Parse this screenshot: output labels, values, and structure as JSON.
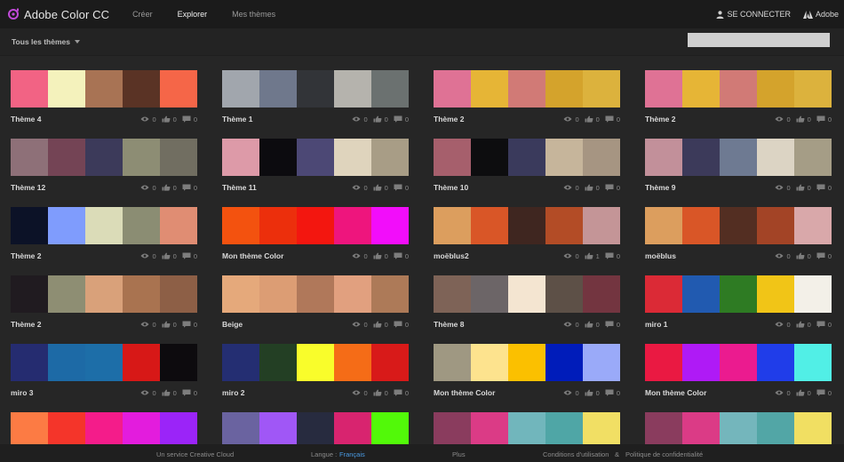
{
  "header": {
    "brand": "Adobe Color CC",
    "nav": [
      "Créer",
      "Explorer",
      "Mes thèmes"
    ],
    "active_nav": 1,
    "connect_label": "SE CONNECTER",
    "adobe_label": "Adobe"
  },
  "filter": {
    "label": "Tous les thèmes",
    "search_value": ""
  },
  "themes": [
    {
      "name": "Thème 4",
      "colors": [
        "#f26384",
        "#f4f2bc",
        "#a87354",
        "#5a3325",
        "#f56648"
      ],
      "views": "0",
      "likes": "0",
      "comments": "0"
    },
    {
      "name": "Thème 1",
      "colors": [
        "#a1a6ad",
        "#6f788c",
        "#323438",
        "#b5b3ad",
        "#6b7170"
      ],
      "views": "0",
      "likes": "0",
      "comments": "0"
    },
    {
      "name": "Thème 2",
      "colors": [
        "#df7295",
        "#e6b536",
        "#d17a76",
        "#d4a32c",
        "#dcb23d"
      ],
      "views": "0",
      "likes": "0",
      "comments": "0"
    },
    {
      "name": "Thème 2",
      "colors": [
        "#df7295",
        "#e6b536",
        "#d17a76",
        "#d4a32c",
        "#dcb23d"
      ],
      "views": "0",
      "likes": "0",
      "comments": "0"
    },
    {
      "name": "Thème 12",
      "colors": [
        "#8e7078",
        "#744455",
        "#3c3a5a",
        "#8d8d74",
        "#716e61"
      ],
      "views": "0",
      "likes": "0",
      "comments": "0"
    },
    {
      "name": "Thème 11",
      "colors": [
        "#dd9aa8",
        "#0c0b0f",
        "#4c4875",
        "#dfd4bd",
        "#a89d86"
      ],
      "views": "0",
      "likes": "0",
      "comments": "0"
    },
    {
      "name": "Thème 10",
      "colors": [
        "#a65f6c",
        "#0d0d0f",
        "#3a3a5c",
        "#c6b59b",
        "#a69582"
      ],
      "views": "0",
      "likes": "0",
      "comments": "0"
    },
    {
      "name": "Thème 9",
      "colors": [
        "#c2909a",
        "#3c3a5a",
        "#6e7a92",
        "#dcd4c4",
        "#a59d86"
      ],
      "views": "0",
      "likes": "0",
      "comments": "0"
    },
    {
      "name": "Thème 2",
      "colors": [
        "#0c1227",
        "#7f9cfd",
        "#dbdcb8",
        "#8b8d73",
        "#e08d73"
      ],
      "views": "0",
      "likes": "0",
      "comments": "0"
    },
    {
      "name": "Mon thème Color",
      "colors": [
        "#f3520f",
        "#ec2f0c",
        "#f3160f",
        "#ee157d",
        "#f20dfa"
      ],
      "views": "0",
      "likes": "0",
      "comments": "0"
    },
    {
      "name": "moëblus2",
      "colors": [
        "#dc9e5e",
        "#d95627",
        "#3f2620",
        "#b34c26",
        "#c49597"
      ],
      "views": "0",
      "likes": "1",
      "comments": "0"
    },
    {
      "name": "moëblus",
      "colors": [
        "#dc9e5e",
        "#d95627",
        "#532e22",
        "#a34426",
        "#d9a8aa"
      ],
      "views": "0",
      "likes": "0",
      "comments": "0"
    },
    {
      "name": "Thème 2",
      "colors": [
        "#201b20",
        "#8e8e73",
        "#d9a17a",
        "#a97350",
        "#8d5f46"
      ],
      "views": "0",
      "likes": "0",
      "comments": "0"
    },
    {
      "name": "Beige",
      "colors": [
        "#e5a97b",
        "#dc9d74",
        "#b0785a",
        "#e1a07f",
        "#ad7a58"
      ],
      "views": "0",
      "likes": "0",
      "comments": "0"
    },
    {
      "name": "Thème 8",
      "colors": [
        "#7e6357",
        "#6c6567",
        "#f4e5d1",
        "#5d5047",
        "#733540"
      ],
      "views": "0",
      "likes": "0",
      "comments": "0"
    },
    {
      "name": "miro 1",
      "colors": [
        "#db2a36",
        "#215ab0",
        "#2e7b23",
        "#f1c517",
        "#f3f0e8"
      ],
      "views": "0",
      "likes": "0",
      "comments": "0"
    },
    {
      "name": "miro 3",
      "colors": [
        "#252c70",
        "#1d6aa6",
        "#1d6ea8",
        "#d71817",
        "#0d0b0e"
      ],
      "views": "0",
      "likes": "0",
      "comments": "0"
    },
    {
      "name": "miro 2",
      "colors": [
        "#242e72",
        "#233f24",
        "#f9fd2b",
        "#f56c17",
        "#d81a19"
      ],
      "views": "0",
      "likes": "0",
      "comments": "0"
    },
    {
      "name": "Mon thème Color",
      "colors": [
        "#9f9882",
        "#fde38e",
        "#fbc000",
        "#001cba",
        "#9aaaf9"
      ],
      "views": "0",
      "likes": "0",
      "comments": "0"
    },
    {
      "name": "Mon thème Color",
      "colors": [
        "#ea1942",
        "#af1af6",
        "#eb1b8f",
        "#203de9",
        "#51efe6"
      ],
      "views": "0",
      "likes": "0",
      "comments": "0"
    },
    {
      "name": "",
      "colors": [
        "#fc7b44",
        "#f4352a",
        "#f41c8a",
        "#e31cdd",
        "#9b24f8"
      ],
      "views": "",
      "likes": "",
      "comments": ""
    },
    {
      "name": "",
      "colors": [
        "#6a63a0",
        "#a057f6",
        "#272b3f",
        "#d8246f",
        "#52f909"
      ],
      "views": "",
      "likes": "",
      "comments": ""
    },
    {
      "name": "",
      "colors": [
        "#8a3c5e",
        "#db3b86",
        "#71b6bc",
        "#4fa6a6",
        "#f1df64"
      ],
      "views": "",
      "likes": "",
      "comments": ""
    },
    {
      "name": "",
      "colors": [
        "#8a3c5e",
        "#db3b86",
        "#74b6bc",
        "#52a6a6",
        "#f1df62"
      ],
      "views": "",
      "likes": "",
      "comments": ""
    }
  ],
  "footer": {
    "service": "Un service Creative Cloud",
    "language_label": "Langue :",
    "language_value": "Français",
    "more": "Plus",
    "terms": "Conditions d'utilisation",
    "amp": "&",
    "privacy": "Politique de confidentialité"
  }
}
